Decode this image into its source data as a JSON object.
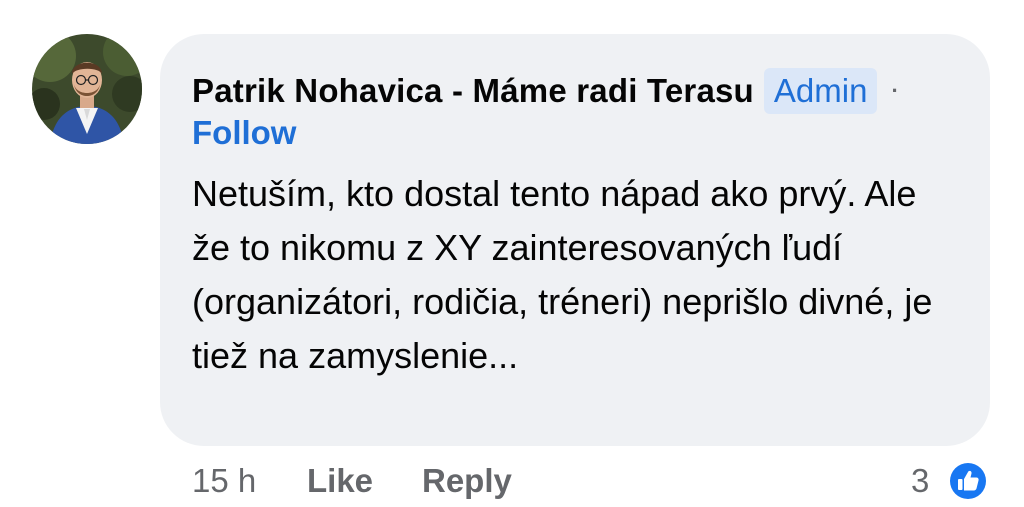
{
  "comment": {
    "author": "Patrik Nohavica - Máme radi Terasu",
    "badge": "Admin",
    "separator": "·",
    "follow_label": "Follow",
    "text": "Netuším, kto dostal tento nápad ako prvý. Ale že to nikomu z XY zainteresovaných ľudí (organizátori, rodičia, tréneri) neprišlo divné, je tiež na zamyslenie...",
    "timestamp": "15 h",
    "like_label": "Like",
    "reply_label": "Reply",
    "reaction_count": "3",
    "reaction_icon": "thumbs-up-icon"
  },
  "colors": {
    "bubble_bg": "#eff1f4",
    "link_blue": "#1f6fd6",
    "badge_bg": "#dbe7f8",
    "muted_text": "#65676b",
    "main_text": "#050505",
    "like_blue": "#1877f2"
  }
}
